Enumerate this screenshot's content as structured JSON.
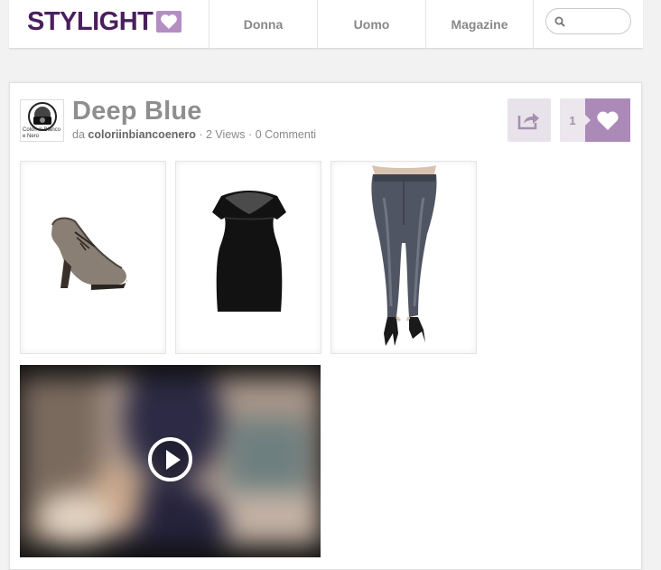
{
  "header": {
    "logo_text": "STYLIGHT",
    "nav": [
      {
        "label": "Donna"
      },
      {
        "label": "Uomo"
      },
      {
        "label": "Magazine"
      }
    ],
    "search": {
      "placeholder": "",
      "value": ""
    }
  },
  "post": {
    "title": "Deep Blue",
    "avatar_caption": "Colori in Bianco e Nero",
    "meta": {
      "prefix": "da",
      "author": "coloriinbiancoenero",
      "sep1": "·",
      "views": "2 Views",
      "sep2": "·",
      "comments": "0 Commenti"
    },
    "likes": "1"
  },
  "products": [
    {
      "name": "shoe"
    },
    {
      "name": "top"
    },
    {
      "name": "jeans"
    }
  ],
  "colors": {
    "brand": "#4a1f5e",
    "accent": "#ab8ab8",
    "accent_light": "#e8e2ea"
  }
}
